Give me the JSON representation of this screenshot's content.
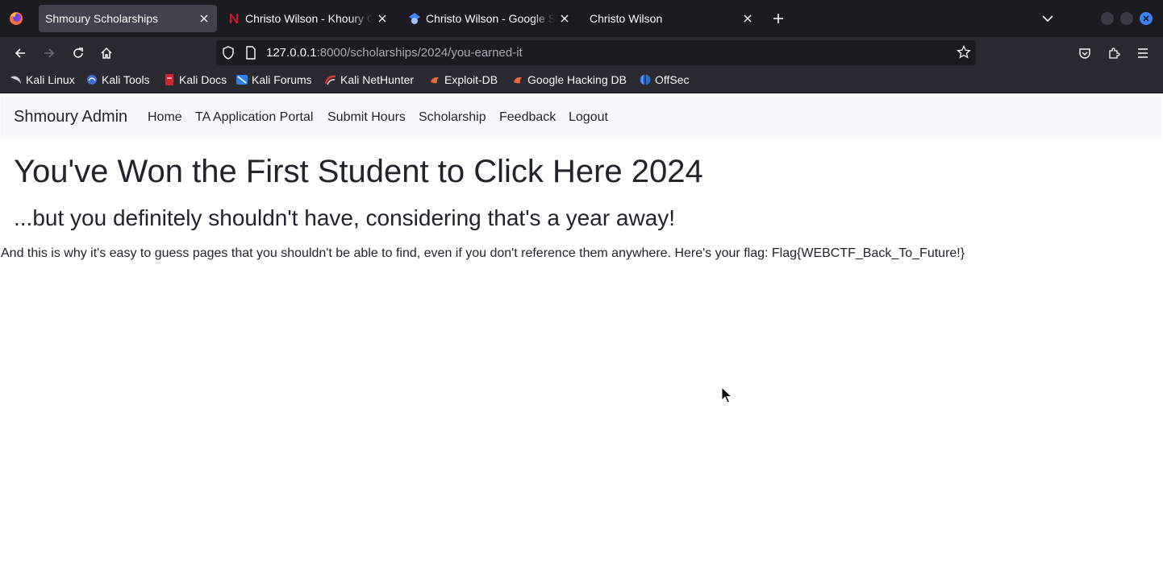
{
  "browser": {
    "tabs": [
      {
        "title": "Shmoury Scholarships",
        "favicon": "firefox-icon",
        "active": true
      },
      {
        "title": "Christo Wilson - Khoury College",
        "favicon": "northeastern-n-icon",
        "active": false
      },
      {
        "title": "Christo Wilson - Google Scholar",
        "favicon": "google-scholar-icon",
        "active": false
      },
      {
        "title": "Christo Wilson",
        "favicon": "",
        "active": false
      }
    ],
    "url": {
      "host": "127.0.0.1",
      "rest": ":8000/scholarships/2024/you-earned-it"
    },
    "bookmarks": [
      {
        "label": "Kali Linux",
        "icon": "kali-dragon-icon"
      },
      {
        "label": "Kali Tools",
        "icon": "kali-tools-icon"
      },
      {
        "label": "Kali Docs",
        "icon": "kali-docs-icon"
      },
      {
        "label": "Kali Forums",
        "icon": "kali-forums-icon"
      },
      {
        "label": "Kali NetHunter",
        "icon": "kali-nethunter-icon"
      },
      {
        "label": "Exploit-DB",
        "icon": "exploit-db-icon"
      },
      {
        "label": "Google Hacking DB",
        "icon": "ghdb-icon"
      },
      {
        "label": "OffSec",
        "icon": "offsec-icon"
      }
    ]
  },
  "site": {
    "brand": "Shmoury Admin",
    "nav": [
      "Home",
      "TA Application Portal",
      "Submit Hours",
      "Scholarship",
      "Feedback",
      "Logout"
    ],
    "heading": "You've Won the First Student to Click Here 2024",
    "subheading": "...but you definitely shouldn't have, considering that's a year away!",
    "paragraph": "And this is why it's easy to guess pages that you shouldn't be able to find, even if you don't reference them anywhere. Here's your flag: Flag{WEBCTF_Back_To_Future!}"
  },
  "colors": {
    "tab_strip": "#1c1b22",
    "toolbar": "#2b2a33",
    "active_tab": "#42414d",
    "site_navbar": "#f8f9fa",
    "text": "#212529",
    "window_close": "#3b82f6"
  }
}
